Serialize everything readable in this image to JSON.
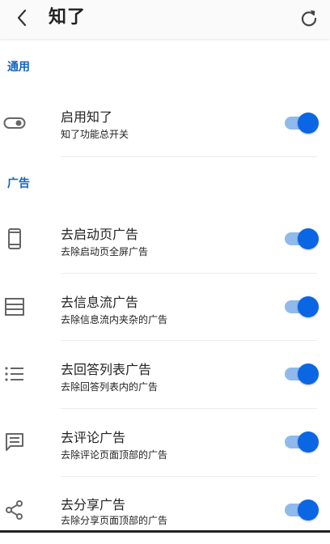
{
  "header": {
    "title": "知了",
    "back_icon": "chevron-left-icon",
    "refresh_icon": "refresh-icon"
  },
  "sections": {
    "general": {
      "title": "通用"
    },
    "ads": {
      "title": "广告"
    }
  },
  "settings": {
    "enable": {
      "label": "启用知了",
      "sub": "知了功能总开关",
      "icon": "toggle-icon",
      "checked": true
    },
    "launch_ad": {
      "label": "去启动页广告",
      "sub": "去除启动页全屏广告",
      "icon": "phone-icon",
      "checked": true
    },
    "feed_ad": {
      "label": "去信息流广告",
      "sub": "去除信息流内夹杂的广告",
      "icon": "feed-icon",
      "checked": true
    },
    "answer_ad": {
      "label": "去回答列表广告",
      "sub": "去除回答列表内的广告",
      "icon": "list-icon",
      "checked": true
    },
    "comment_ad": {
      "label": "去评论广告",
      "sub": "去除评论页面顶部的广告",
      "icon": "comment-icon",
      "checked": true
    },
    "share_ad": {
      "label": "去分享广告",
      "sub": "去除分享页面顶部的广告",
      "icon": "share-icon",
      "checked": true
    }
  },
  "colors": {
    "accent": "#0b66e4",
    "track": "#90b9ee",
    "section": "#1565c0"
  }
}
